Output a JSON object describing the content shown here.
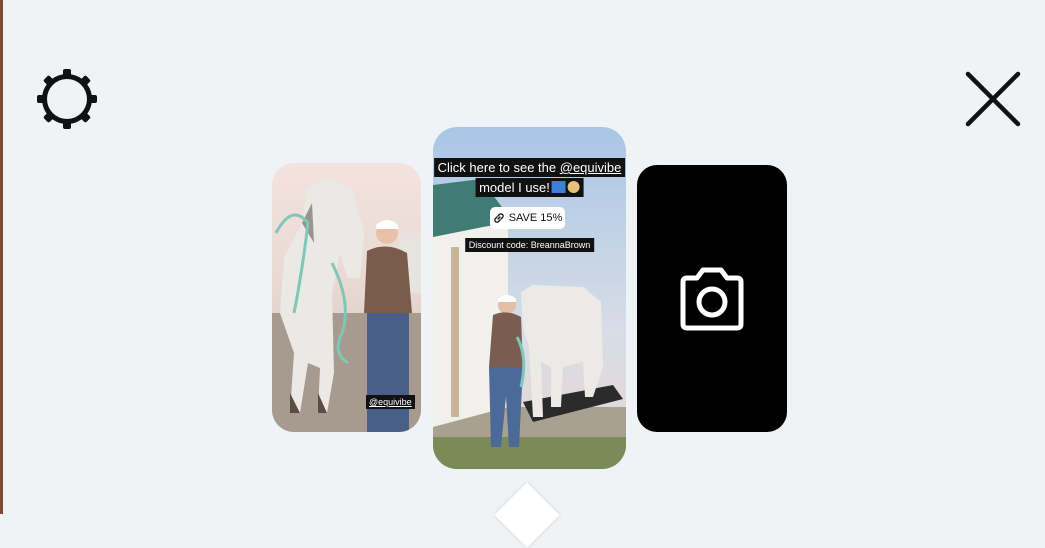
{
  "toolbar": {
    "settings_icon": "gear-icon",
    "close_icon": "close-icon"
  },
  "carousel": {
    "left_card": {
      "tag": "@equivibe"
    },
    "center_card": {
      "caption_line1_prefix": "Click here to see the ",
      "caption_handle": "@equivibe",
      "caption_line2": "model I use!",
      "link_sticker": "SAVE 15%",
      "discount_text": "Discount code: BreannaBrown"
    },
    "camera_card": {
      "icon": "camera-icon"
    }
  },
  "colors": {
    "background": "#eff3f5",
    "camera_card": "#000000"
  }
}
